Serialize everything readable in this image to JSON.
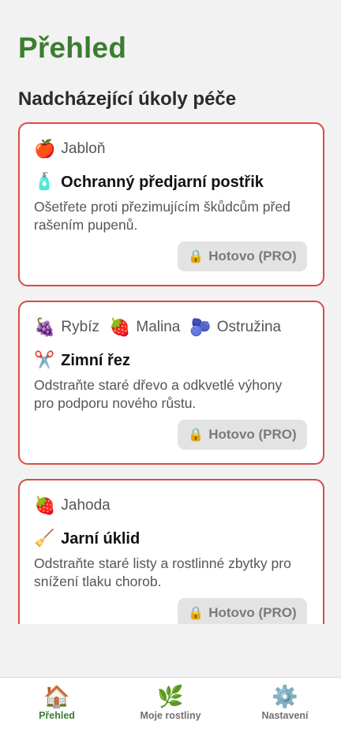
{
  "header": {
    "title": "Přehled"
  },
  "section": {
    "title": "Nadcházející úkoly péče"
  },
  "cards": [
    {
      "plants": [
        {
          "emoji": "🍎",
          "name": "Jabloň"
        }
      ],
      "task_emoji": "🧴",
      "task_title": "Ochranný předjarní postřik",
      "description": "Ošetřete proti přezimujícím škůdcům před rašením pupenů.",
      "button_lock": "🔒",
      "button_label": "Hotovo (PRO)"
    },
    {
      "plants": [
        {
          "emoji": "🍇",
          "name": "Rybíz"
        },
        {
          "emoji": "🍓",
          "name": "Malina"
        },
        {
          "emoji": "🫐",
          "name": "Ostružina"
        }
      ],
      "task_emoji": "✂️",
      "task_title": "Zimní řez",
      "description": "Odstraňte staré dřevo a odkvetlé výhony pro podporu nového růstu.",
      "button_lock": "🔒",
      "button_label": "Hotovo (PRO)"
    },
    {
      "plants": [
        {
          "emoji": "🍓",
          "name": "Jahoda"
        }
      ],
      "task_emoji": "🧹",
      "task_title": "Jarní úklid",
      "description": "Odstraňte staré listy a rostlinné zbytky pro snížení tlaku chorob.",
      "button_lock": "🔒",
      "button_label": "Hotovo (PRO)"
    }
  ],
  "nav": {
    "items": [
      {
        "icon": "🏠",
        "icon_name": "home-icon",
        "label": "Přehled",
        "active": true
      },
      {
        "icon": "🌿",
        "icon_name": "plant-icon",
        "label": "Moje rostliny",
        "active": false
      },
      {
        "icon": "⚙️",
        "icon_name": "gear-icon",
        "label": "Nastavení",
        "active": false
      }
    ]
  },
  "colors": {
    "accent": "#3c7d32",
    "card_border": "#d94c42",
    "background": "#f2f2f2"
  }
}
